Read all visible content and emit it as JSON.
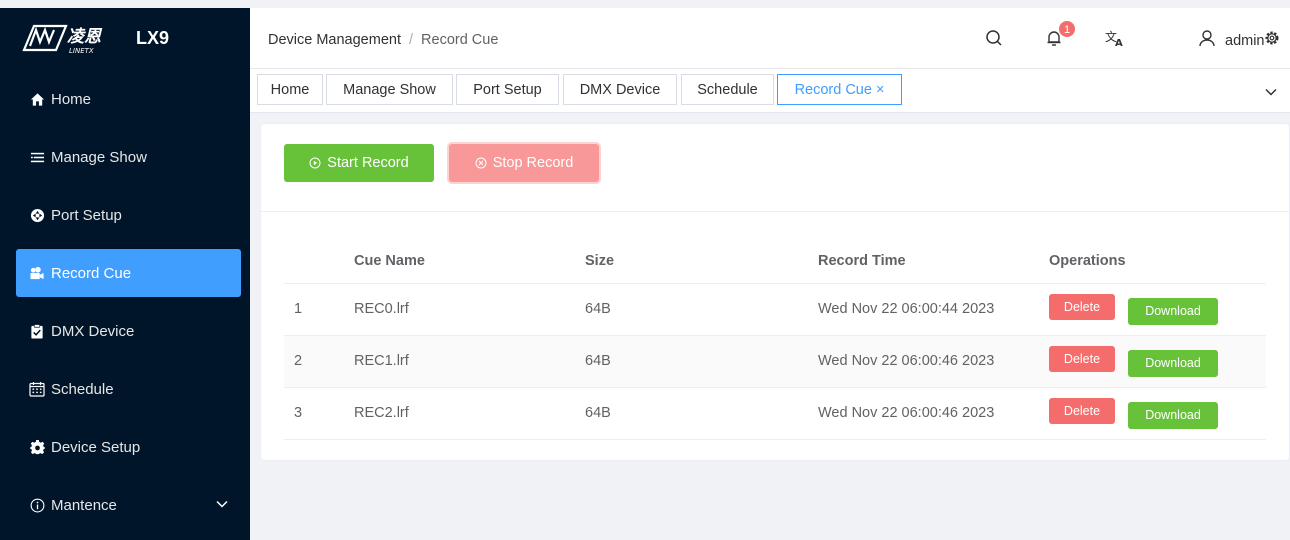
{
  "app": {
    "brand_title": "LX9"
  },
  "sidebar": {
    "items": [
      {
        "label": "Home",
        "icon": "home-icon"
      },
      {
        "label": "Manage Show",
        "icon": "list-icon"
      },
      {
        "label": "Port Setup",
        "icon": "port-icon"
      },
      {
        "label": "Record Cue",
        "icon": "camera-icon",
        "active": true
      },
      {
        "label": "DMX Device",
        "icon": "clipboard-icon"
      },
      {
        "label": "Schedule",
        "icon": "calendar-icon"
      },
      {
        "label": "Device Setup",
        "icon": "gear-icon"
      },
      {
        "label": "Mantence",
        "icon": "info-icon",
        "expandable": true
      }
    ]
  },
  "header": {
    "breadcrumb": [
      "Device Management",
      "Record Cue"
    ],
    "notification_count": "1",
    "username": "admin"
  },
  "tabs": [
    {
      "label": "Home"
    },
    {
      "label": "Manage Show"
    },
    {
      "label": "Port Setup"
    },
    {
      "label": "DMX Device"
    },
    {
      "label": "Schedule"
    },
    {
      "label": "Record Cue ×",
      "active": true
    }
  ],
  "toolbar": {
    "start_label": "Start Record",
    "stop_label": "Stop Record"
  },
  "table": {
    "headers": [
      "",
      "Cue Name",
      "Size",
      "Record Time",
      "Operations"
    ],
    "rows": [
      {
        "index": "1",
        "name": "REC0.lrf",
        "size": "64B",
        "time": "Wed Nov 22 06:00:44 2023"
      },
      {
        "index": "2",
        "name": "REC1.lrf",
        "size": "64B",
        "time": "Wed Nov 22 06:00:46 2023"
      },
      {
        "index": "3",
        "name": "REC2.lrf",
        "size": "64B",
        "time": "Wed Nov 22 06:00:46 2023"
      }
    ],
    "delete_label": "Delete",
    "download_label": "Download"
  },
  "colors": {
    "sidebar_bg": "#001529",
    "accent": "#409eff",
    "success": "#67c23a",
    "danger": "#f56c6c",
    "danger_light": "#f89898"
  }
}
